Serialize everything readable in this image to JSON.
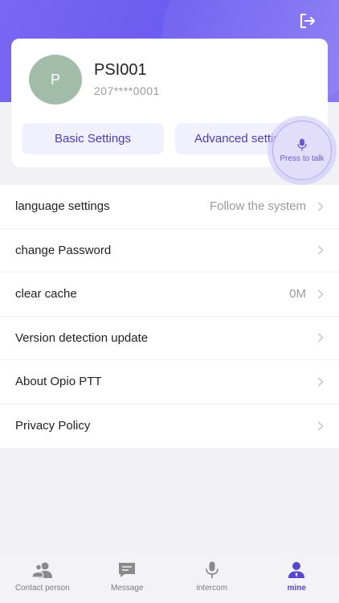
{
  "colors": {
    "accent": "#6d5cf0",
    "avatar_bg": "#a2bcaa",
    "tab_active": "#5545d2",
    "tab_inactive": "#8a8a8a"
  },
  "header": {
    "logout_icon": "logout-icon"
  },
  "profile": {
    "avatar_initial": "P",
    "name": "PSI001",
    "phone": "207****0001",
    "basic_settings_label": "Basic Settings",
    "advanced_settings_label": "Advanced settings"
  },
  "ptt": {
    "label": "Press to talk",
    "icon": "microphone-icon"
  },
  "menu": {
    "items": [
      {
        "label": "language settings",
        "value": "Follow the system"
      },
      {
        "label": "change Password",
        "value": ""
      },
      {
        "label": "clear cache",
        "value": "0M"
      },
      {
        "label": "Version detection update",
        "value": ""
      },
      {
        "label": "About Opio PTT",
        "value": ""
      },
      {
        "label": "Privacy Policy",
        "value": ""
      }
    ]
  },
  "tabbar": {
    "active": "mine",
    "tabs": [
      {
        "label": "Contact person",
        "icon": "contacts-icon"
      },
      {
        "label": "Message",
        "icon": "message-icon"
      },
      {
        "label": "intercom",
        "icon": "microphone-icon"
      },
      {
        "label": "mine",
        "icon": "person-icon"
      }
    ]
  }
}
